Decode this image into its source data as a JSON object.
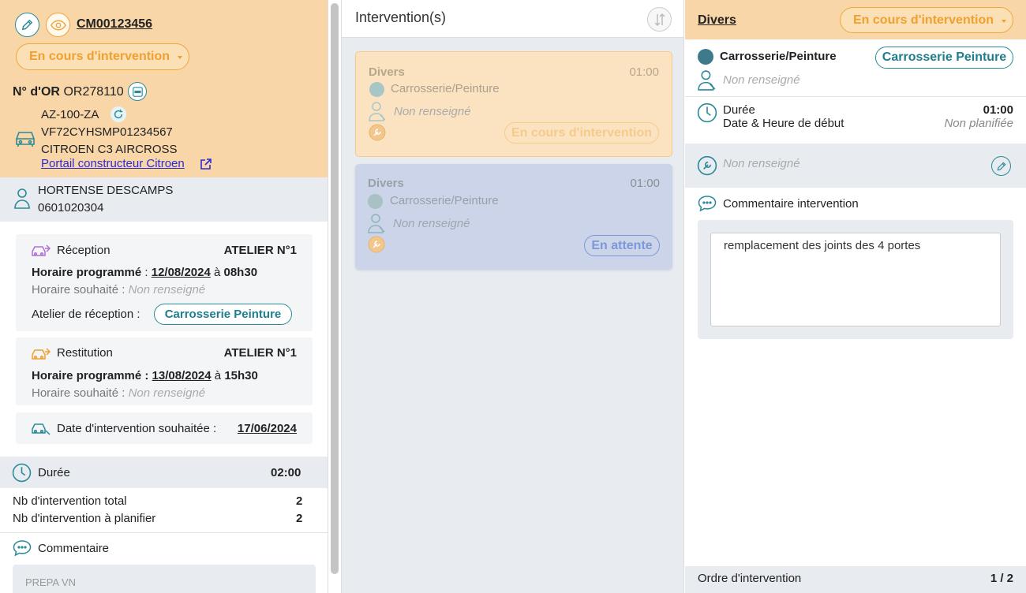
{
  "left": {
    "order_code": "CM00123456",
    "status": "En cours d'intervention",
    "or_label": "N° d'OR",
    "or_number": "OR278110",
    "vehicle": {
      "plate": "AZ-100-ZA",
      "vin": "VF72CYHSMP01234567",
      "model": "CITROEN C3 AIRCROSS",
      "portal_link": "Portail constructeur Citroen"
    },
    "client": {
      "name": "HORTENSE DESCAMPS",
      "phone": "0601020304"
    },
    "reception": {
      "title": "Réception",
      "atelier": "ATELIER N°1",
      "prog_label": "Horaire programmé",
      "prog_date": "12/08/2024",
      "prog_sep": "à",
      "prog_time": "08h30",
      "wish_label": "Horaire souhaité :",
      "wish_value": "Non renseigné",
      "atelier_label": "Atelier de réception :",
      "atelier_value": "Carrosserie Peinture"
    },
    "restitution": {
      "title": "Restitution",
      "atelier": "ATELIER N°1",
      "prog_label": "Horaire programmé :",
      "prog_date": "13/08/2024",
      "prog_sep": "à",
      "prog_time": "15h30",
      "wish_label": "Horaire souhaité :",
      "wish_value": "Non renseigné"
    },
    "wish_date": {
      "label": "Date d'intervention souhaitée :",
      "value": "17/06/2024"
    },
    "duree": {
      "label": "Durée",
      "value": "02:00"
    },
    "stats": [
      {
        "label": "Nb d'intervention total",
        "value": "2"
      },
      {
        "label": "Nb d'intervention à planifier",
        "value": "2"
      }
    ],
    "comment": {
      "label": "Commentaire",
      "value": "PREPA VN"
    }
  },
  "middle": {
    "title": "Intervention(s)",
    "cards": [
      {
        "title": "Divers",
        "time": "01:00",
        "category": "Carrosserie/Peinture",
        "assignee": "Non renseigné",
        "status": "En cours d'intervention"
      },
      {
        "title": "Divers",
        "time": "01:00",
        "category": "Carrosserie/Peinture",
        "assignee": "Non renseigné",
        "status": "En attente"
      }
    ]
  },
  "right": {
    "title": "Divers",
    "status": "En cours d'intervention",
    "category": "Carrosserie/Peinture",
    "category_pill": "Carrosserie Peinture",
    "assignee": "Non renseigné",
    "duree_label": "Durée",
    "duree_value": "01:00",
    "start_label": "Date & Heure de début",
    "start_value": "Non planifiée",
    "tech": "Non renseigné",
    "comment_label": "Commentaire intervention",
    "comment_value": "remplacement des joints des 4 portes",
    "footer_label": "Ordre d'intervention",
    "footer_value": "1 / 2"
  },
  "colors": {
    "accent_teal": "#2a8a99",
    "status_orange": "#f0a030",
    "header_peach": "#f8d6a8",
    "panel_gray": "#e8ebef",
    "card_waiting_blue": "#c9d3e8"
  }
}
